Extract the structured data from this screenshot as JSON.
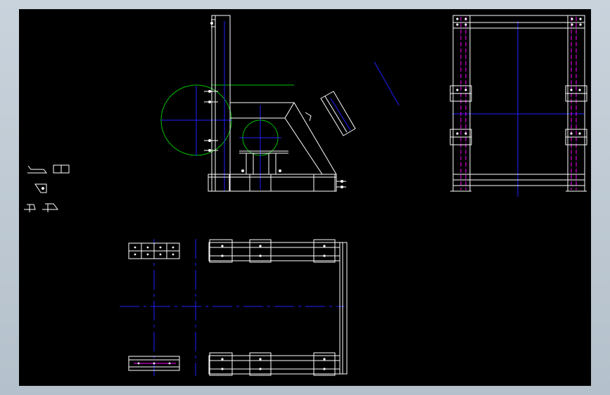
{
  "drawing": {
    "background": "#000000",
    "frame_color": "#c3ccd5",
    "colors": {
      "outline": "#ffffff",
      "centerline": "#2020ff",
      "construction": "#00c000",
      "hidden": "#ff00ff"
    },
    "views": [
      "side-elevation-view",
      "front-elevation-view",
      "plan-view",
      "detail-symbols"
    ]
  }
}
